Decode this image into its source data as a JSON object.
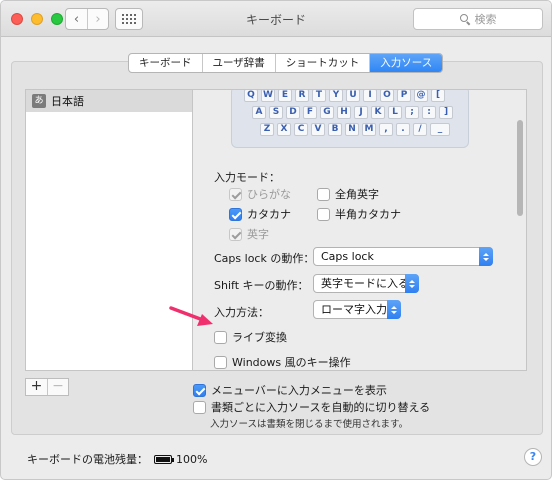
{
  "window": {
    "title": "キーボード"
  },
  "toolbar": {
    "back_label": "‹",
    "forward_label": "›",
    "search_placeholder": "検索"
  },
  "tabs": [
    {
      "label": "キーボード",
      "active": false
    },
    {
      "label": "ユーザ辞書",
      "active": false
    },
    {
      "label": "ショートカット",
      "active": false
    },
    {
      "label": "入力ソース",
      "active": true
    }
  ],
  "sources": [
    {
      "icon": "あ",
      "label": "日本語"
    }
  ],
  "source_controls": {
    "add": "+",
    "remove": "−"
  },
  "keyboard_preview": {
    "rows": [
      [
        "Q",
        "W",
        "E",
        "R",
        "T",
        "Y",
        "U",
        "I",
        "O",
        "P",
        "@",
        "["
      ],
      [
        "A",
        "S",
        "D",
        "F",
        "G",
        "H",
        "J",
        "K",
        "L",
        ";",
        ":",
        "]"
      ],
      [
        "Z",
        "X",
        "C",
        "V",
        "B",
        "N",
        "M",
        ",",
        ".",
        "/",
        "_"
      ]
    ]
  },
  "input_modes": {
    "label": "入力モード：",
    "items": [
      {
        "label": "ひらがな",
        "checked": true,
        "disabled": true
      },
      {
        "label": "全角英字",
        "checked": false,
        "disabled": false
      },
      {
        "label": "カタカナ",
        "checked": true,
        "disabled": false
      },
      {
        "label": "半角カタカナ",
        "checked": false,
        "disabled": false
      },
      {
        "label": "英字",
        "checked": true,
        "disabled": true
      }
    ]
  },
  "caps_lock": {
    "label": "Caps lock の動作：",
    "value": "Caps lock"
  },
  "shift": {
    "label": "Shift キーの動作：",
    "value": "英字モードに入る"
  },
  "input_method": {
    "label": "入力方法：",
    "value": "ローマ字入力"
  },
  "live_conversion": {
    "label": "ライブ変換",
    "checked": false
  },
  "windows_keys": {
    "label": "Windows 風のキー操作",
    "checked": false
  },
  "menu_bar": {
    "label": "メニューバーに入力メニューを表示",
    "checked": true
  },
  "auto_switch": {
    "label": "書類ごとに入力ソースを自動的に切り替える",
    "checked": false,
    "note": "入力ソースは書類を閉じるまで使用されます。"
  },
  "battery": {
    "label": "キーボードの電池残量：",
    "value": "100%",
    "level": 1.0
  },
  "help": {
    "label": "?"
  },
  "colors": {
    "accent": "#2f7ff1",
    "pointer": "#f0306e"
  }
}
